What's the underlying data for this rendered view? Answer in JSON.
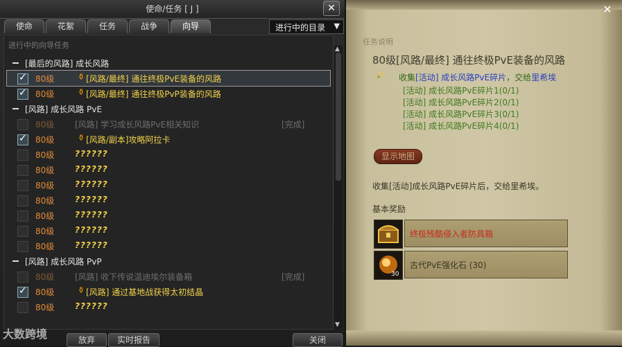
{
  "window": {
    "title": "使命/任务 [ J ]",
    "close_label": "✕"
  },
  "tabs": [
    {
      "label": "使命",
      "active": false
    },
    {
      "label": "花絮",
      "active": false
    },
    {
      "label": "任务",
      "active": false
    },
    {
      "label": "战争",
      "active": false
    },
    {
      "label": "向导",
      "active": true
    }
  ],
  "filter": {
    "selected": "进行中的目录"
  },
  "list": {
    "header": "进行中的向导任务",
    "rows": [
      {
        "type": "group",
        "label": "[最后的风路] 成长风路"
      },
      {
        "type": "item",
        "checked": true,
        "level": "80级",
        "name": "[风路/最终] 通往终极PvE装备的风路",
        "selected": true
      },
      {
        "type": "item",
        "checked": true,
        "level": "80级",
        "name": "[风路/最终] 通往终极PvP装备的风路"
      },
      {
        "type": "group",
        "label": "[风路] 成长风路 PvE"
      },
      {
        "type": "item",
        "checked": false,
        "level": "80级",
        "name": "[风路] 学习成长风路PvE相关知识",
        "status": "[完成]",
        "done": true
      },
      {
        "type": "item",
        "checked": true,
        "level": "80级",
        "name": "[风路/副本]攻略阿拉卡"
      },
      {
        "type": "item",
        "checked": false,
        "level": "80级",
        "name": "??????",
        "unknown": true
      },
      {
        "type": "item",
        "checked": false,
        "level": "80级",
        "name": "??????",
        "unknown": true
      },
      {
        "type": "item",
        "checked": false,
        "level": "80级",
        "name": "??????",
        "unknown": true
      },
      {
        "type": "item",
        "checked": false,
        "level": "80级",
        "name": "??????",
        "unknown": true
      },
      {
        "type": "item",
        "checked": false,
        "level": "80级",
        "name": "??????",
        "unknown": true
      },
      {
        "type": "item",
        "checked": false,
        "level": "80级",
        "name": "??????",
        "unknown": true
      },
      {
        "type": "item",
        "checked": false,
        "level": "80级",
        "name": "??????",
        "unknown": true
      },
      {
        "type": "group",
        "label": "[风路] 成长风路 PvP"
      },
      {
        "type": "item",
        "checked": false,
        "level": "80级",
        "name": "[风路] 收下传说温迪埃尔装备箱",
        "status": "[完成]",
        "done": true
      },
      {
        "type": "item",
        "checked": true,
        "level": "80级",
        "name": "[风路] 通过基地战获得太初结晶"
      },
      {
        "type": "item",
        "checked": false,
        "level": "80级",
        "name": "??????",
        "unknown": true
      }
    ]
  },
  "footer": {
    "buttons": [
      "放弃",
      "实时报告",
      "关闭"
    ],
    "watermark": "大数跨境"
  },
  "detail": {
    "section_label": "任务说明",
    "title": "80级[风路/最终] 通往终极PvE装备的风路",
    "objective": {
      "prefix": "收集",
      "item": "[活动] 成长风路PvE碎片",
      "mid": "，交给",
      "npc": "里希埃"
    },
    "sub_objectives": [
      "[活动] 成长风路PvE碎片1(0/1)",
      "[活动] 成长风路PvE碎片2(0/1)",
      "[活动] 成长风路PvE碎片3(0/1)",
      "[活动] 成长风路PvE碎片4(0/1)"
    ],
    "map_button": "显示地图",
    "description": "收集[活动]成长风路PvE碎片后，交给里希埃。",
    "reward_label": "基本奖励",
    "rewards": [
      {
        "name": "终极残酷侵入者防具箱",
        "color": "#c8281e",
        "icon": "treasure-chest-icon"
      },
      {
        "name": "古代PvE强化石 (30)",
        "color": "#3a3324",
        "icon": "enhance-stone-icon",
        "count": "30"
      }
    ]
  },
  "colors": {
    "accent_level": "#e08a3a",
    "quest_name": "#f2d24b",
    "objective_green": "#3f7a1e"
  }
}
